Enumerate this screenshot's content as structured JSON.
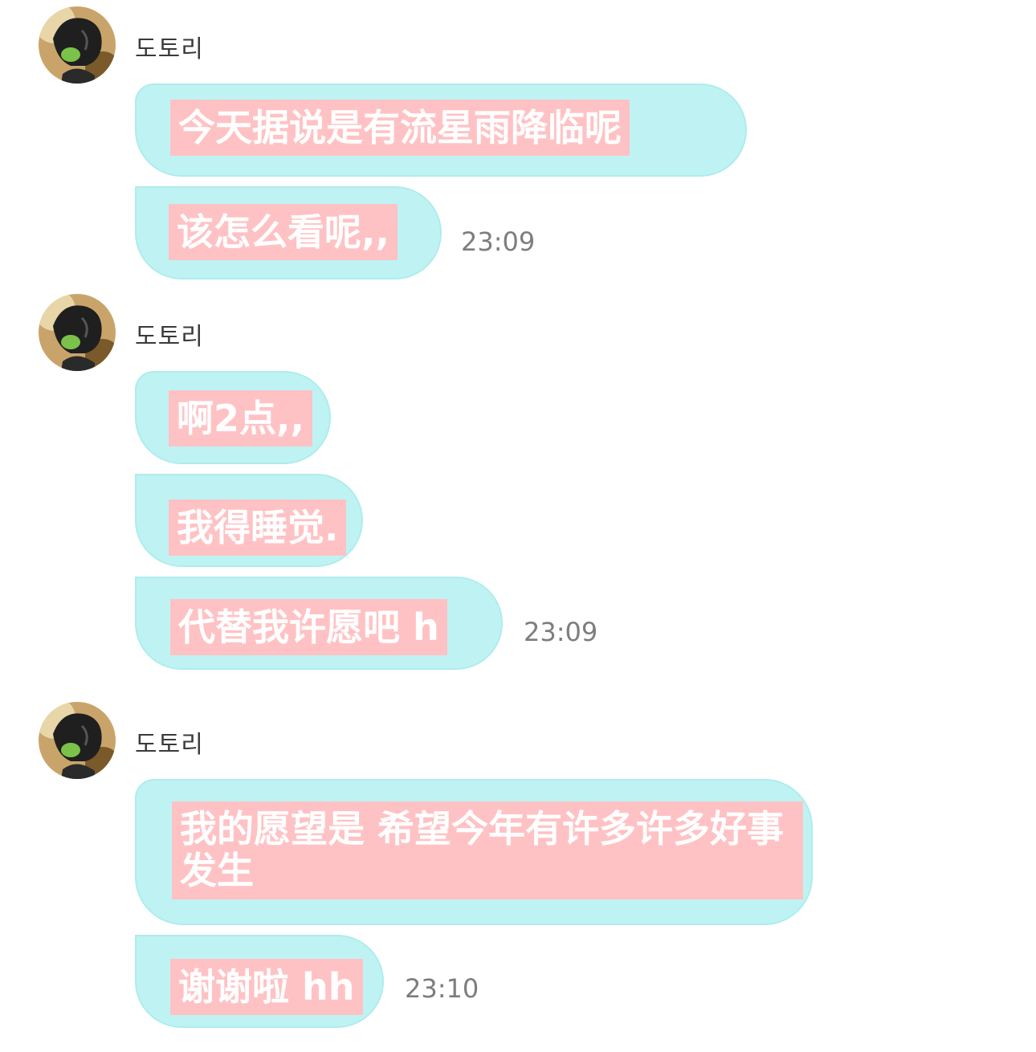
{
  "chat": {
    "groups": [
      {
        "sender": "도토리",
        "messages": [
          {
            "text": "今天据说是有流星雨降临呢"
          },
          {
            "text": "该怎么看呢,,",
            "time": "23:09"
          }
        ]
      },
      {
        "sender": "도토리",
        "messages": [
          {
            "text": "啊2点,,"
          },
          {
            "text": "我得睡觉."
          },
          {
            "text": "代替我许愿吧 h",
            "time": "23:09"
          }
        ]
      },
      {
        "sender": "도토리",
        "messages": [
          {
            "text": "我的愿望是 希望今年有许多许多好事发生"
          },
          {
            "text": "谢谢啦 hh",
            "time": "23:10"
          }
        ]
      }
    ]
  },
  "colors": {
    "bubble_fill": "#bff3f3",
    "bubble_border": "#aeeced",
    "highlight": "#ffc2c4",
    "message_text": "#ffffff",
    "timestamp": "#7d7d7d",
    "sender_name": "#3a3a3a"
  },
  "icons": {
    "avatar": "profile-avatar-icon"
  }
}
